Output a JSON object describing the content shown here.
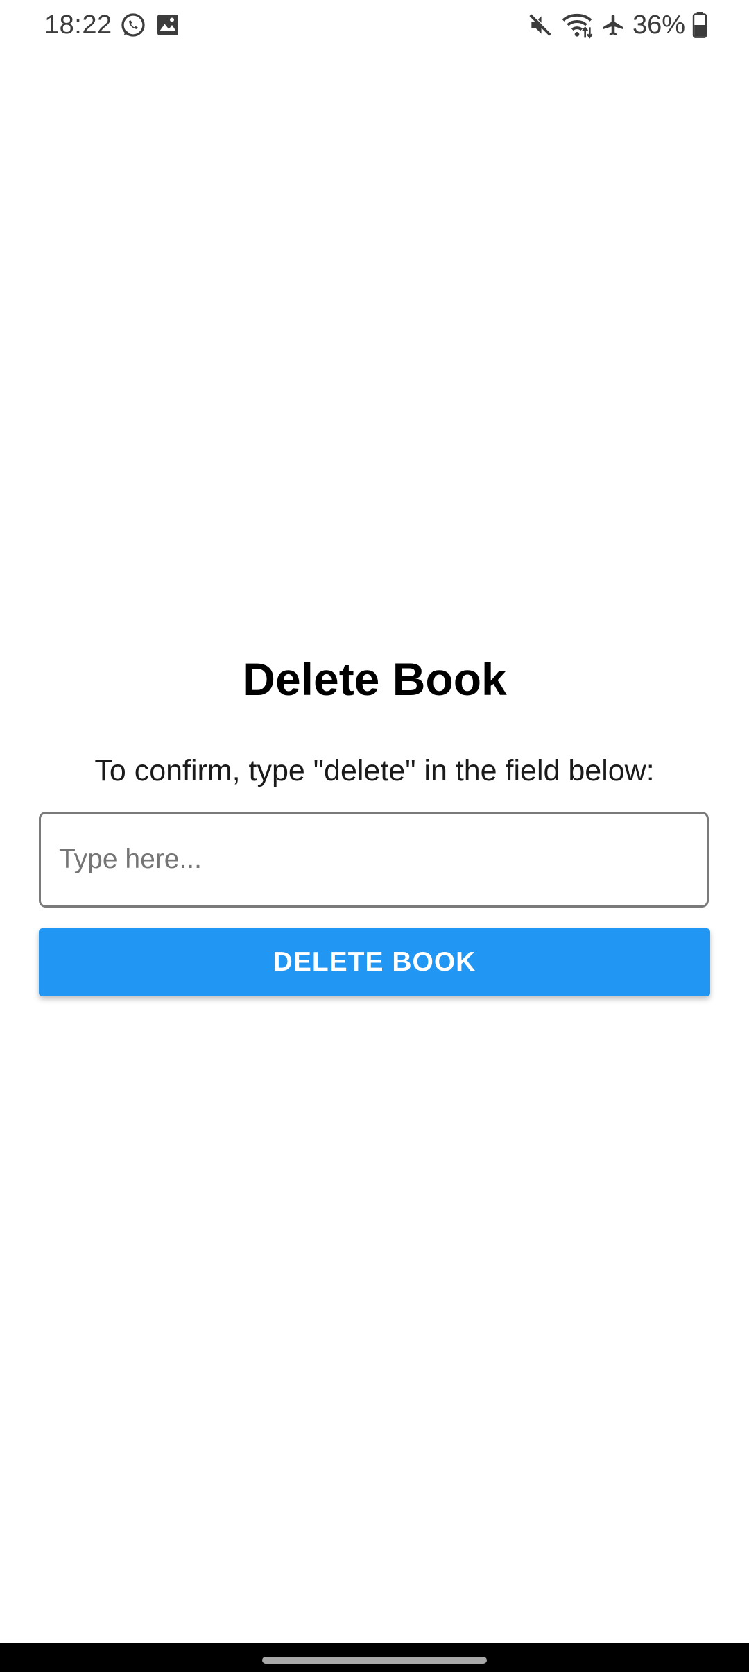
{
  "status_bar": {
    "time": "18:22",
    "left_icons": [
      "whatsapp-icon",
      "image-icon"
    ],
    "right_icons": [
      "mute-icon",
      "wifi-icon",
      "airplane-icon",
      "battery-icon"
    ],
    "battery": "36%"
  },
  "page": {
    "title": "Delete Book",
    "instruction": "To confirm, type \"delete\" in the field below:",
    "input": {
      "value": "",
      "placeholder": "Type here..."
    },
    "button_label": "DELETE BOOK"
  },
  "colors": {
    "accent": "#2196f3",
    "button_text": "#ffffff",
    "background": "#ffffff",
    "nav_bar": "#000000"
  }
}
